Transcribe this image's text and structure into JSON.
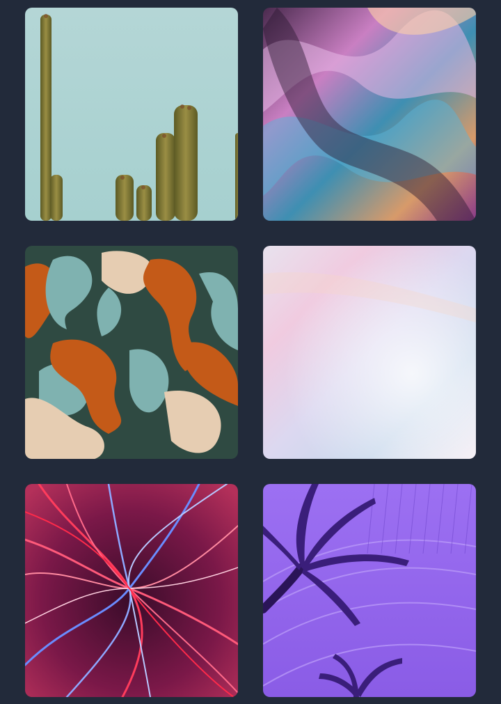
{
  "gallery": {
    "background_color": "#222a3a",
    "items": [
      {
        "subject": "cactus-against-sky",
        "colors": [
          "#b4d8d6",
          "#7a7a32"
        ]
      },
      {
        "subject": "iridescent-fabric",
        "colors": [
          "#3a1f3f",
          "#d47ab8",
          "#4ba3c4"
        ]
      },
      {
        "subject": "marbled-camouflage",
        "colors": [
          "#2f4a42",
          "#c45a18",
          "#7fb2b0",
          "#e8d2b8"
        ]
      },
      {
        "subject": "pastel-gradient",
        "colors": [
          "#f4eef4",
          "#c9d6ea",
          "#f0c8dc"
        ]
      },
      {
        "subject": "neon-light-trails",
        "colors": [
          "#2a0830",
          "#ff3c5c",
          "#6a8cff"
        ]
      },
      {
        "subject": "purple-palm-tree",
        "colors": [
          "#9a6cf0",
          "#3a1e7a"
        ]
      }
    ]
  }
}
